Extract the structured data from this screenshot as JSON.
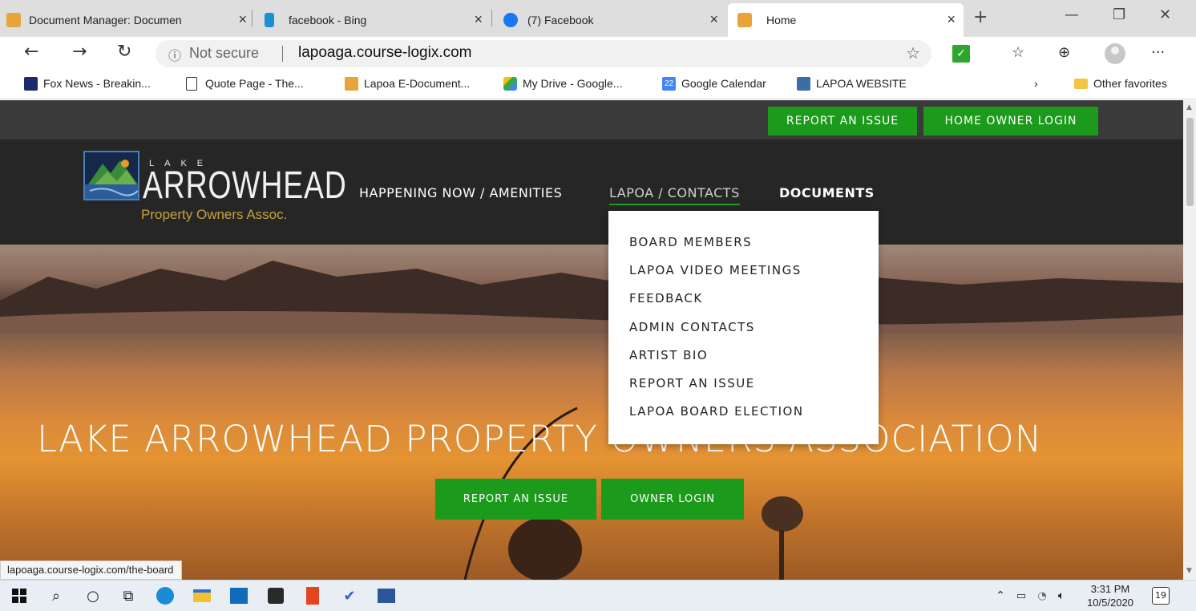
{
  "browser": {
    "tabs": [
      {
        "title": "Document Manager: Documen",
        "icon": "joomla-icon",
        "active": false
      },
      {
        "title": "facebook - Bing",
        "icon": "bing-icon",
        "active": false
      },
      {
        "title": "(7) Facebook",
        "icon": "facebook-icon",
        "active": false
      },
      {
        "title": "Home",
        "icon": "joomla-icon",
        "active": true
      }
    ],
    "address": {
      "security": "Not secure",
      "url": "lapoaga.course-logix.com"
    },
    "favorites": [
      {
        "label": "Fox News - Breakin...",
        "icon": "fox-news-icon"
      },
      {
        "label": "Quote Page - The...",
        "icon": "page-icon"
      },
      {
        "label": "Lapoa E-Document...",
        "icon": "joomla-icon"
      },
      {
        "label": "My Drive - Google...",
        "icon": "google-drive-icon"
      },
      {
        "label": "Google Calendar",
        "icon": "google-calendar-icon",
        "badge": "22"
      },
      {
        "label": "LAPOA WEBSITE",
        "icon": "lapoa-icon"
      }
    ],
    "other_favorites": "Other favorites",
    "status_url": "lapoaga.course-logix.com/the-board"
  },
  "site": {
    "top_buttons": {
      "report": "REPORT AN ISSUE",
      "login": "HOME OWNER LOGIN"
    },
    "logo": {
      "lake": "LAKE",
      "name": "ARROWHEAD",
      "sub": "Property Owners Assoc."
    },
    "nav": {
      "happening": "HAPPENING NOW / AMENITIES",
      "contacts": "LAPOA / CONTACTS",
      "documents": "DOCUMENTS"
    },
    "dropdown": [
      "BOARD MEMBERS",
      "LAPOA VIDEO MEETINGS",
      "FEEDBACK",
      "ADMIN CONTACTS",
      "ARTIST BIO",
      "REPORT AN ISSUE",
      "LAPOA BOARD ELECTION"
    ],
    "hero": {
      "title": "LAKE ARROWHEAD PROPERTY OWNERS ASSOCIATION",
      "report": "REPORT AN ISSUE",
      "login": "OWNER LOGIN"
    }
  },
  "taskbar": {
    "time": "3:31 PM",
    "date": "10/5/2020",
    "notifications": "19"
  },
  "colors": {
    "accent_green": "#1b9a1b",
    "header_dark": "#262626",
    "strip_dark": "#3a3a3a"
  }
}
